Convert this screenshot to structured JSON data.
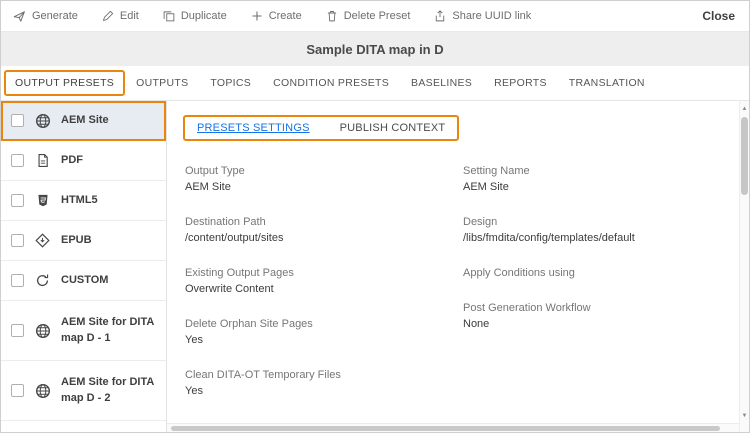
{
  "toolbar": {
    "items": [
      {
        "label": "Generate",
        "icon": "send-icon"
      },
      {
        "label": "Edit",
        "icon": "pencil-icon"
      },
      {
        "label": "Duplicate",
        "icon": "duplicate-icon"
      },
      {
        "label": "Create",
        "icon": "plus-icon"
      },
      {
        "label": "Delete Preset",
        "icon": "trash-icon"
      },
      {
        "label": "Share UUID link",
        "icon": "share-icon"
      }
    ],
    "close_label": "Close"
  },
  "title_bar": {
    "title": "Sample DITA map in D"
  },
  "tabs": [
    {
      "label": "OUTPUT PRESETS",
      "active": true,
      "highlighted": true
    },
    {
      "label": "OUTPUTS"
    },
    {
      "label": "TOPICS"
    },
    {
      "label": "CONDITION PRESETS"
    },
    {
      "label": "BASELINES"
    },
    {
      "label": "REPORTS"
    },
    {
      "label": "TRANSLATION"
    }
  ],
  "sidebar": {
    "items": [
      {
        "label": "AEM Site",
        "icon": "globe-icon",
        "selected": true,
        "highlighted": true
      },
      {
        "label": "PDF",
        "icon": "pdf-icon"
      },
      {
        "label": "HTML5",
        "icon": "html5-icon"
      },
      {
        "label": "EPUB",
        "icon": "epub-icon"
      },
      {
        "label": "CUSTOM",
        "icon": "custom-icon"
      },
      {
        "label": "AEM Site for DITA map D - 1",
        "icon": "globe-icon"
      },
      {
        "label": "AEM Site for DITA map D - 2",
        "icon": "globe-icon"
      }
    ]
  },
  "main": {
    "sub_tabs": [
      {
        "label": "PRESETS SETTINGS",
        "active": true
      },
      {
        "label": "PUBLISH CONTEXT"
      }
    ],
    "fields_left": [
      {
        "label": "Output Type",
        "value": "AEM Site"
      },
      {
        "label": "Destination Path",
        "value": "/content/output/sites"
      },
      {
        "label": "Existing Output Pages",
        "value": "Overwrite Content"
      },
      {
        "label": "Delete Orphan Site Pages",
        "value": "Yes"
      },
      {
        "label": "Clean DITA-OT Temporary Files",
        "value": "Yes"
      }
    ],
    "fields_right": [
      {
        "label": "Setting Name",
        "value": "AEM Site"
      },
      {
        "label": "Design",
        "value": "/libs/fmdita/config/templates/default"
      },
      {
        "label": "Apply Conditions using",
        "value": ""
      },
      {
        "label": "Post Generation Workflow",
        "value": "None"
      }
    ]
  },
  "colors": {
    "annotation_orange": "#e8860d",
    "link_blue": "#1473e6",
    "titlebar_gray": "#eeeeee",
    "selected_row": "#e6ecf2"
  }
}
